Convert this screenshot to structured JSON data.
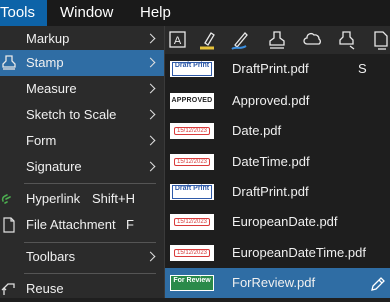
{
  "menubar": {
    "tools": "Tools",
    "window": "Window",
    "help": "Help"
  },
  "tools_menu": {
    "items": [
      {
        "label": "Markup"
      },
      {
        "label": "Stamp"
      },
      {
        "label": "Measure"
      },
      {
        "label": "Sketch to Scale"
      },
      {
        "label": "Form"
      },
      {
        "label": "Signature"
      },
      {
        "label": "Hyperlink",
        "shortcut": "Shift+H"
      },
      {
        "label": "File Attachment",
        "shortcut": "F"
      },
      {
        "label": "Toolbars"
      },
      {
        "label": "Reuse"
      }
    ]
  },
  "toolbar": {
    "icons": [
      "text-box-icon",
      "highlighter-icon",
      "pen-icon",
      "stamp-icon",
      "cloud-icon",
      "stamp-alt-icon",
      "more-icon"
    ],
    "text_box_letter": "A",
    "accent": "#3b8fe0",
    "highlight": "#e6c23a"
  },
  "stamps": {
    "items": [
      {
        "name": "DraftPrint.pdf",
        "hotkey": "S",
        "thumb_text": "Draft Print",
        "thumb_sub": ""
      },
      {
        "name": "Approved.pdf",
        "thumb_text": "APPROVED"
      },
      {
        "name": "Date.pdf",
        "thumb_text": "15/12/2023"
      },
      {
        "name": "DateTime.pdf",
        "thumb_text": "15/12/2023"
      },
      {
        "name": "DraftPrint.pdf",
        "thumb_text": "Draft Print",
        "thumb_sub": ""
      },
      {
        "name": "EuropeanDate.pdf",
        "thumb_text": "15/12/2023"
      },
      {
        "name": "EuropeanDateTime.pdf",
        "thumb_text": "15/12/2023"
      },
      {
        "name": "ForReview.pdf",
        "thumb_text": "For Review",
        "thumb_sub": ""
      }
    ]
  },
  "colors": {
    "selected": "#2f6da4",
    "menubar_active": "#0d63a8",
    "stamp_blue": "#2f5aa8",
    "stamp_red": "#d93a3a",
    "stamp_green": "#2a8a4a"
  }
}
